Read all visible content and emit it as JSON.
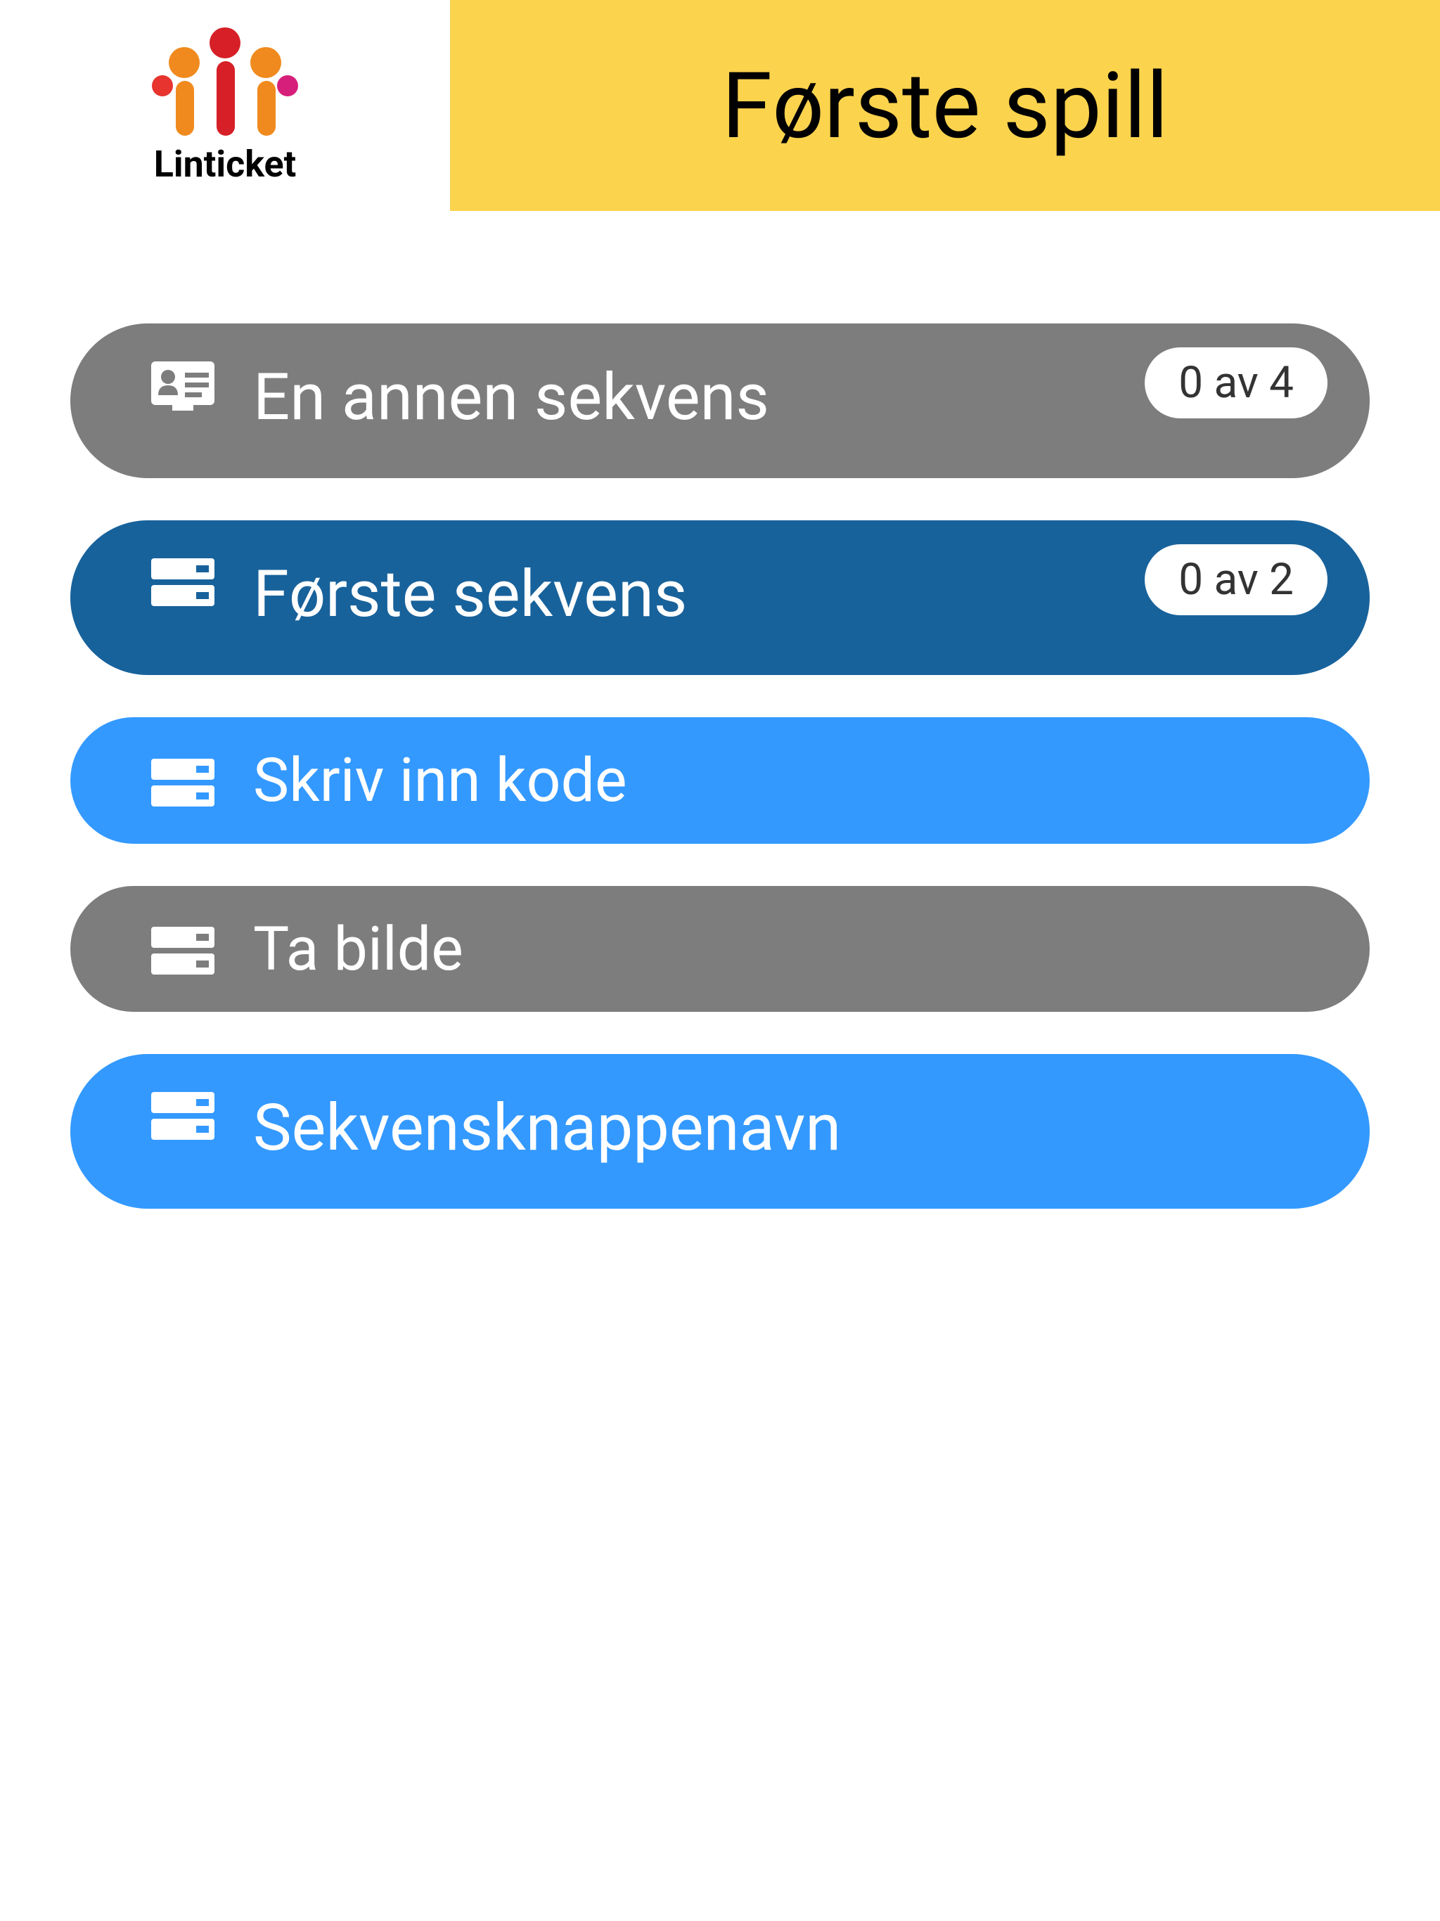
{
  "header": {
    "brand": "Linticket",
    "title": "Første spill"
  },
  "items": [
    {
      "label": "En annen sekvens",
      "badge": "0 av 4",
      "style": "grey",
      "size": "large",
      "icon": "id-card-icon"
    },
    {
      "label": "Første sekvens",
      "badge": "0 av 2",
      "style": "darkblue",
      "size": "large",
      "icon": "server-icon"
    },
    {
      "label": "Skriv inn kode",
      "badge": null,
      "style": "blue",
      "size": "small",
      "icon": "server-icon"
    },
    {
      "label": "Ta bilde",
      "badge": null,
      "style": "grey",
      "size": "small",
      "icon": "server-icon"
    },
    {
      "label": "Sekvensknappenavn",
      "badge": null,
      "style": "blue",
      "size": "large",
      "icon": "server-icon"
    }
  ]
}
